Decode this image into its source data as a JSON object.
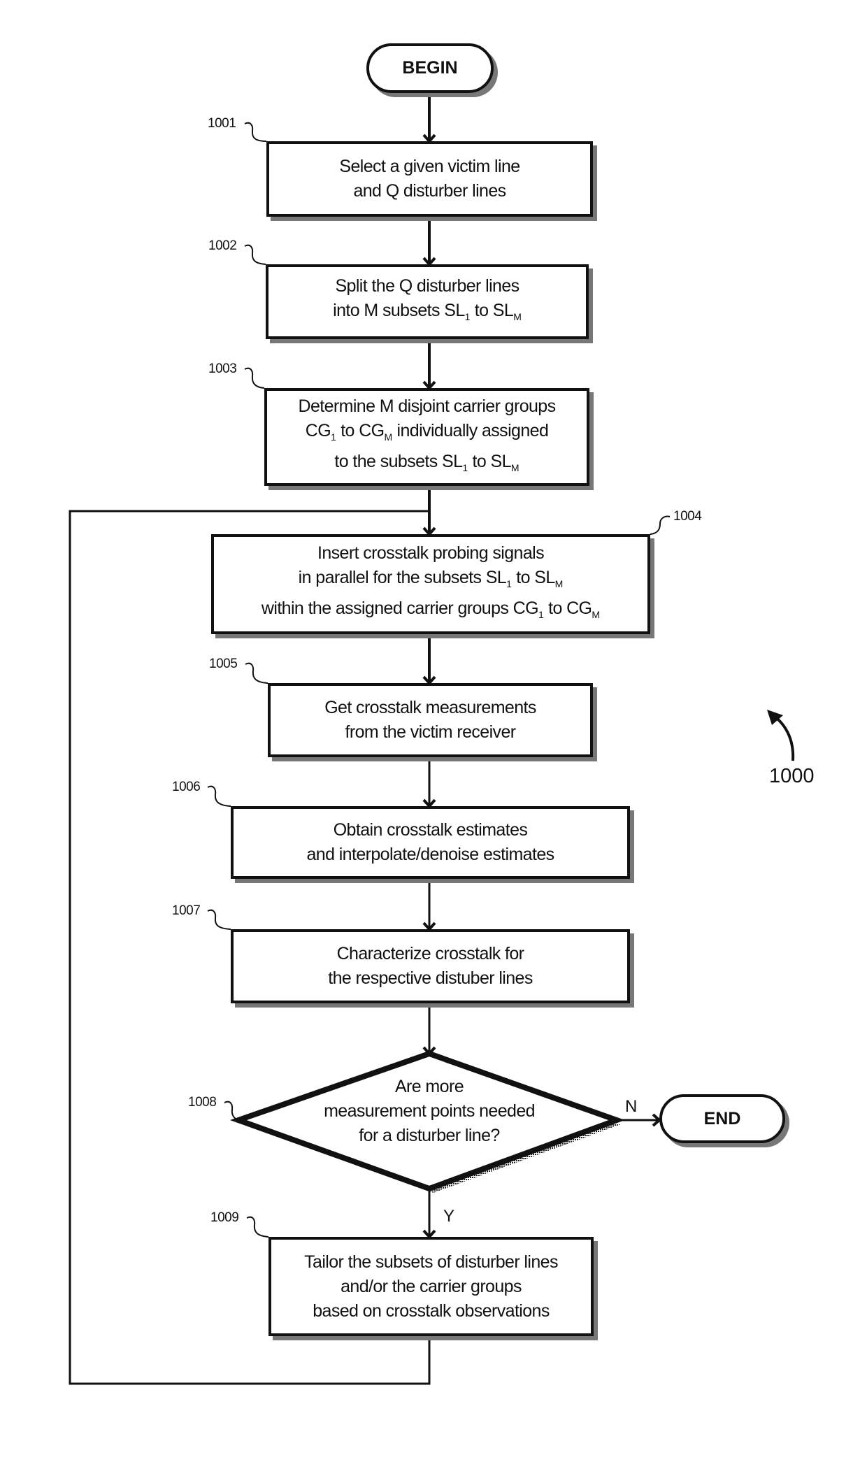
{
  "figure": {
    "figure_number": "1000",
    "nodes": {
      "begin": {
        "label": "BEGIN"
      },
      "end": {
        "label": "END"
      },
      "step_1001": {
        "ref": "1001",
        "lines": [
          {
            "text": "Select a given victim line"
          },
          {
            "text": "and Q disturber lines"
          }
        ]
      },
      "step_1002": {
        "ref": "1002",
        "lines": [
          {
            "text": "Split the Q disturber lines"
          },
          {
            "parts": [
              "into M subsets SL",
              "1",
              " to SL",
              "M"
            ]
          }
        ]
      },
      "step_1003": {
        "ref": "1003",
        "lines": [
          {
            "text": "Determine M disjoint carrier groups"
          },
          {
            "parts": [
              "CG",
              "1",
              " to CG",
              "M",
              " individually assigned"
            ]
          },
          {
            "parts": [
              "to the subsets SL",
              "1",
              " to SL",
              "M"
            ]
          }
        ]
      },
      "step_1004": {
        "ref": "1004",
        "lines": [
          {
            "text": "Insert crosstalk probing signals"
          },
          {
            "parts": [
              "in parallel for the subsets SL",
              "1",
              " to SL",
              "M"
            ]
          },
          {
            "parts": [
              "within the assigned carrier groups CG",
              "1",
              " to CG",
              "M"
            ]
          }
        ]
      },
      "step_1005": {
        "ref": "1005",
        "lines": [
          {
            "text": "Get crosstalk measurements"
          },
          {
            "text": "from the victim receiver"
          }
        ]
      },
      "step_1006": {
        "ref": "1006",
        "lines": [
          {
            "text": "Obtain crosstalk estimates"
          },
          {
            "text": "and interpolate/denoise estimates"
          }
        ]
      },
      "step_1007": {
        "ref": "1007",
        "lines": [
          {
            "text": "Characterize crosstalk for"
          },
          {
            "text": "the respective distuber lines"
          }
        ]
      },
      "decision_1008": {
        "ref": "1008",
        "lines": [
          {
            "text": "Are more"
          },
          {
            "text": "measurement points needed"
          },
          {
            "text": "for a disturber line?"
          }
        ],
        "no_label": "N",
        "yes_label": "Y"
      },
      "step_1009": {
        "ref": "1009",
        "lines": [
          {
            "text": "Tailor the subsets of disturber lines"
          },
          {
            "text": "and/or the carrier groups"
          },
          {
            "text": "based on crosstalk observations"
          }
        ]
      }
    },
    "edges": [
      {
        "from": "begin",
        "to": "step_1001"
      },
      {
        "from": "step_1001",
        "to": "step_1002"
      },
      {
        "from": "step_1002",
        "to": "step_1003"
      },
      {
        "from": "step_1003",
        "to": "step_1004"
      },
      {
        "from": "step_1004",
        "to": "step_1005"
      },
      {
        "from": "step_1005",
        "to": "step_1006"
      },
      {
        "from": "step_1006",
        "to": "step_1007"
      },
      {
        "from": "step_1007",
        "to": "decision_1008"
      },
      {
        "from": "decision_1008",
        "to": "end",
        "label": "N"
      },
      {
        "from": "decision_1008",
        "to": "step_1009",
        "label": "Y"
      },
      {
        "from": "step_1009",
        "to": "step_1004",
        "label": "loop"
      }
    ]
  }
}
